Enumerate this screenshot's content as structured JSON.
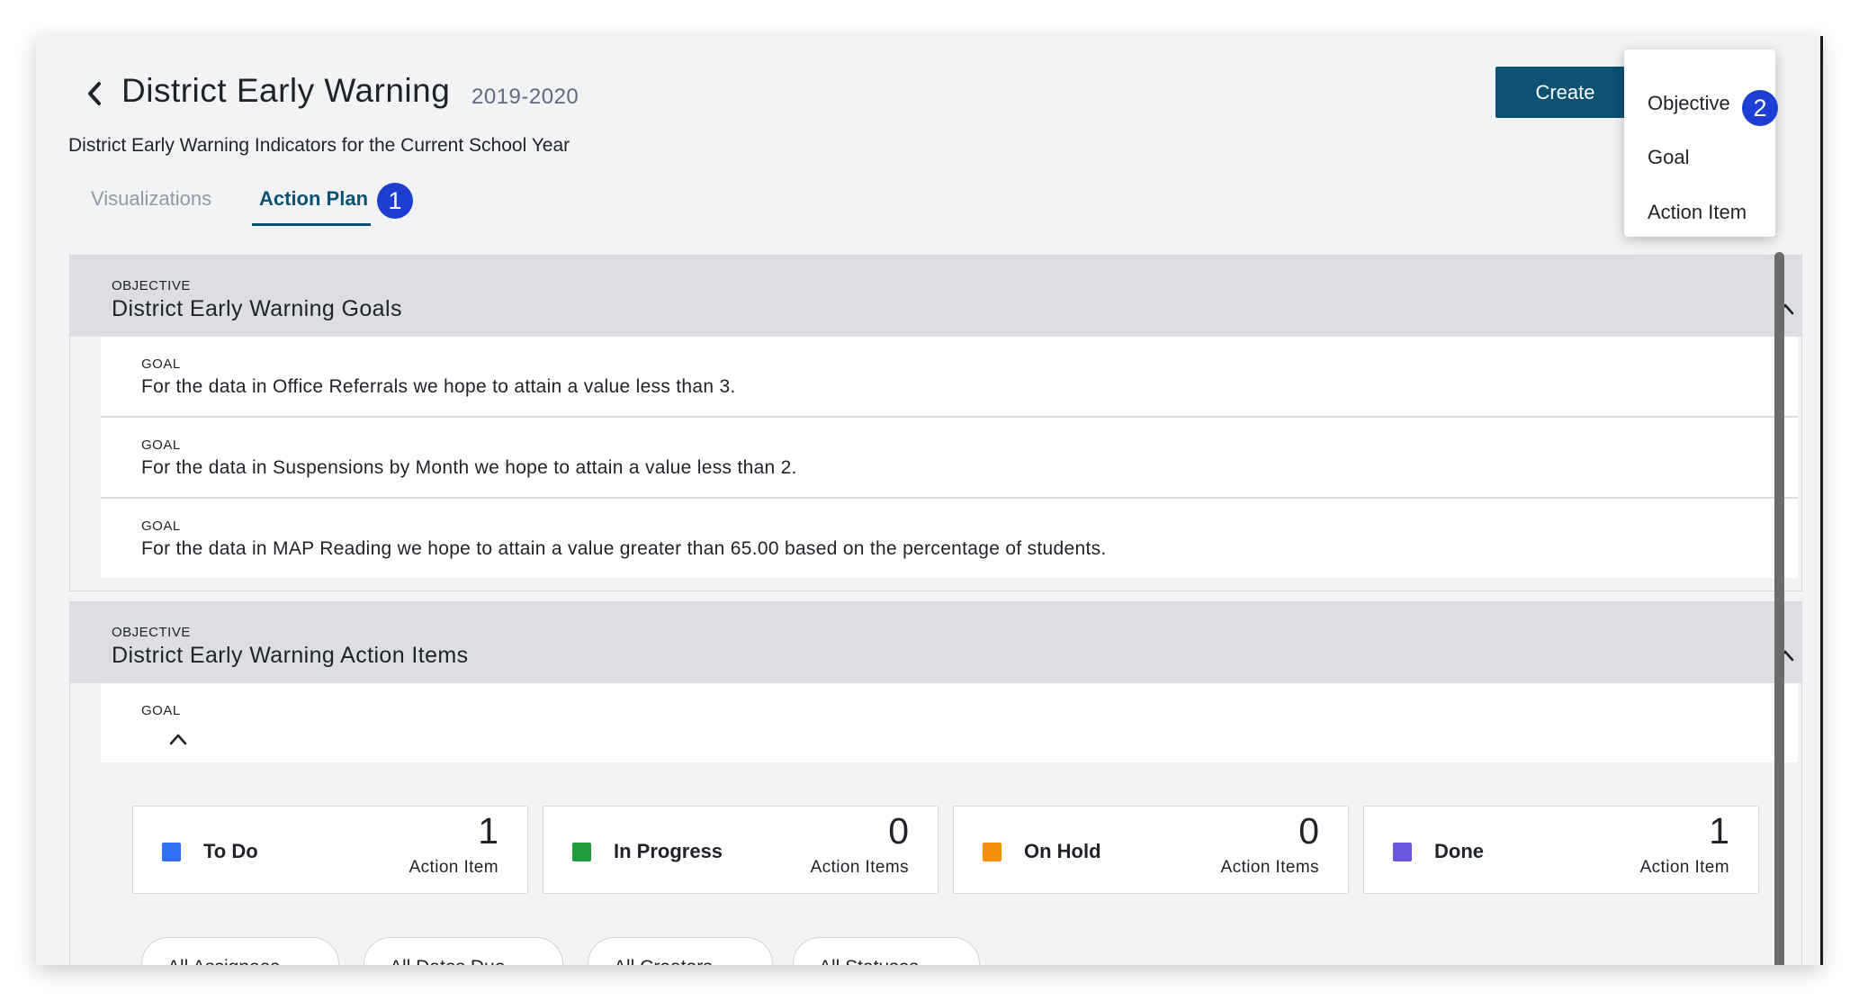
{
  "header": {
    "title": "District Early Warning",
    "year": "2019-2020",
    "subtitle": "District Early Warning Indicators for the Current School Year",
    "create_label": "Create"
  },
  "tabs": [
    {
      "label": "Visualizations",
      "active": false
    },
    {
      "label": "Action Plan",
      "active": true
    }
  ],
  "annotations": {
    "badge_1": "1",
    "badge_2": "2"
  },
  "create_menu": {
    "items": [
      "Objective",
      "Goal",
      "Action Item"
    ]
  },
  "objectives": [
    {
      "kicker": "OBJECTIVE",
      "title": "District Early Warning Goals",
      "goals": [
        {
          "kicker": "GOAL",
          "text": "For the data in Office Referrals we hope to attain a value less than 3."
        },
        {
          "kicker": "GOAL",
          "text": "For the data in Suspensions by Month we hope to attain a value less than 2."
        },
        {
          "kicker": "GOAL",
          "text": "For the data in MAP Reading we hope to attain a value greater than 65.00 based on the percentage of students."
        }
      ]
    },
    {
      "kicker": "OBJECTIVE",
      "title": "District Early Warning Action Items",
      "goal": {
        "kicker": "GOAL"
      },
      "statuses": [
        {
          "label": "To Do",
          "count": "1",
          "unit": "Action Item",
          "color": "#2f6ff0"
        },
        {
          "label": "In Progress",
          "count": "0",
          "unit": "Action Items",
          "color": "#1f9c3f"
        },
        {
          "label": "On Hold",
          "count": "0",
          "unit": "Action Items",
          "color": "#f5900c"
        },
        {
          "label": "Done",
          "count": "1",
          "unit": "Action Item",
          "color": "#6a58e0"
        }
      ],
      "filters": [
        "All Assignees",
        "All Dates Due",
        "All Creators",
        "All Statuses"
      ]
    }
  ],
  "colors": {
    "accent": "#0c5273",
    "badge": "#1e3ed2"
  }
}
